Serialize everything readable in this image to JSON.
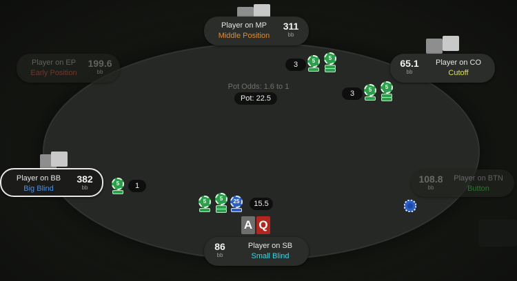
{
  "table": {
    "pot_odds": "Pot Odds: 1.6 to 1",
    "pot": "Pot: 22.5"
  },
  "seats": {
    "mp": {
      "name": "Player on MP",
      "position": "Middle Position",
      "stack": "311",
      "unit": "bb",
      "color": "#e08a2c",
      "status": "active"
    },
    "co": {
      "name": "Player on CO",
      "position": "Cutoff",
      "stack": "65.1",
      "unit": "bb",
      "color": "#e4e24a",
      "status": "active"
    },
    "ep": {
      "name": "Player on EP",
      "position": "Early Position",
      "stack": "199.6",
      "unit": "bb",
      "color": "#a4483f",
      "status": "folded"
    },
    "bb": {
      "name": "Player on BB",
      "position": "Big Blind",
      "stack": "382",
      "unit": "bb",
      "color": "#4d8fe0",
      "status": "to-act"
    },
    "btn": {
      "name": "Player on BTN",
      "position": "Button",
      "stack": "108.8",
      "unit": "bb",
      "color": "#3aa544",
      "status": "folded"
    },
    "sb": {
      "name": "Player on SB",
      "position": "Small Blind",
      "stack": "86",
      "unit": "bb",
      "color": "#3fd3e3",
      "status": "hero"
    }
  },
  "bets": {
    "mp": "3",
    "co": "3",
    "bb": "1",
    "sb": "15.5"
  },
  "chips": {
    "mp": [
      "5",
      "5"
    ],
    "co": [
      "5",
      "5"
    ],
    "bb": [
      "5"
    ],
    "sb": [
      "5",
      "5",
      "25"
    ]
  },
  "hero_cards": [
    {
      "rank": "A",
      "color": "#6e6e6e"
    },
    {
      "rank": "Q",
      "color": "#b3261e"
    }
  ],
  "icons": {
    "dealer": "dealer-button-icon",
    "chip": "poker-chip-icon",
    "card_back": "card-back-icon"
  }
}
